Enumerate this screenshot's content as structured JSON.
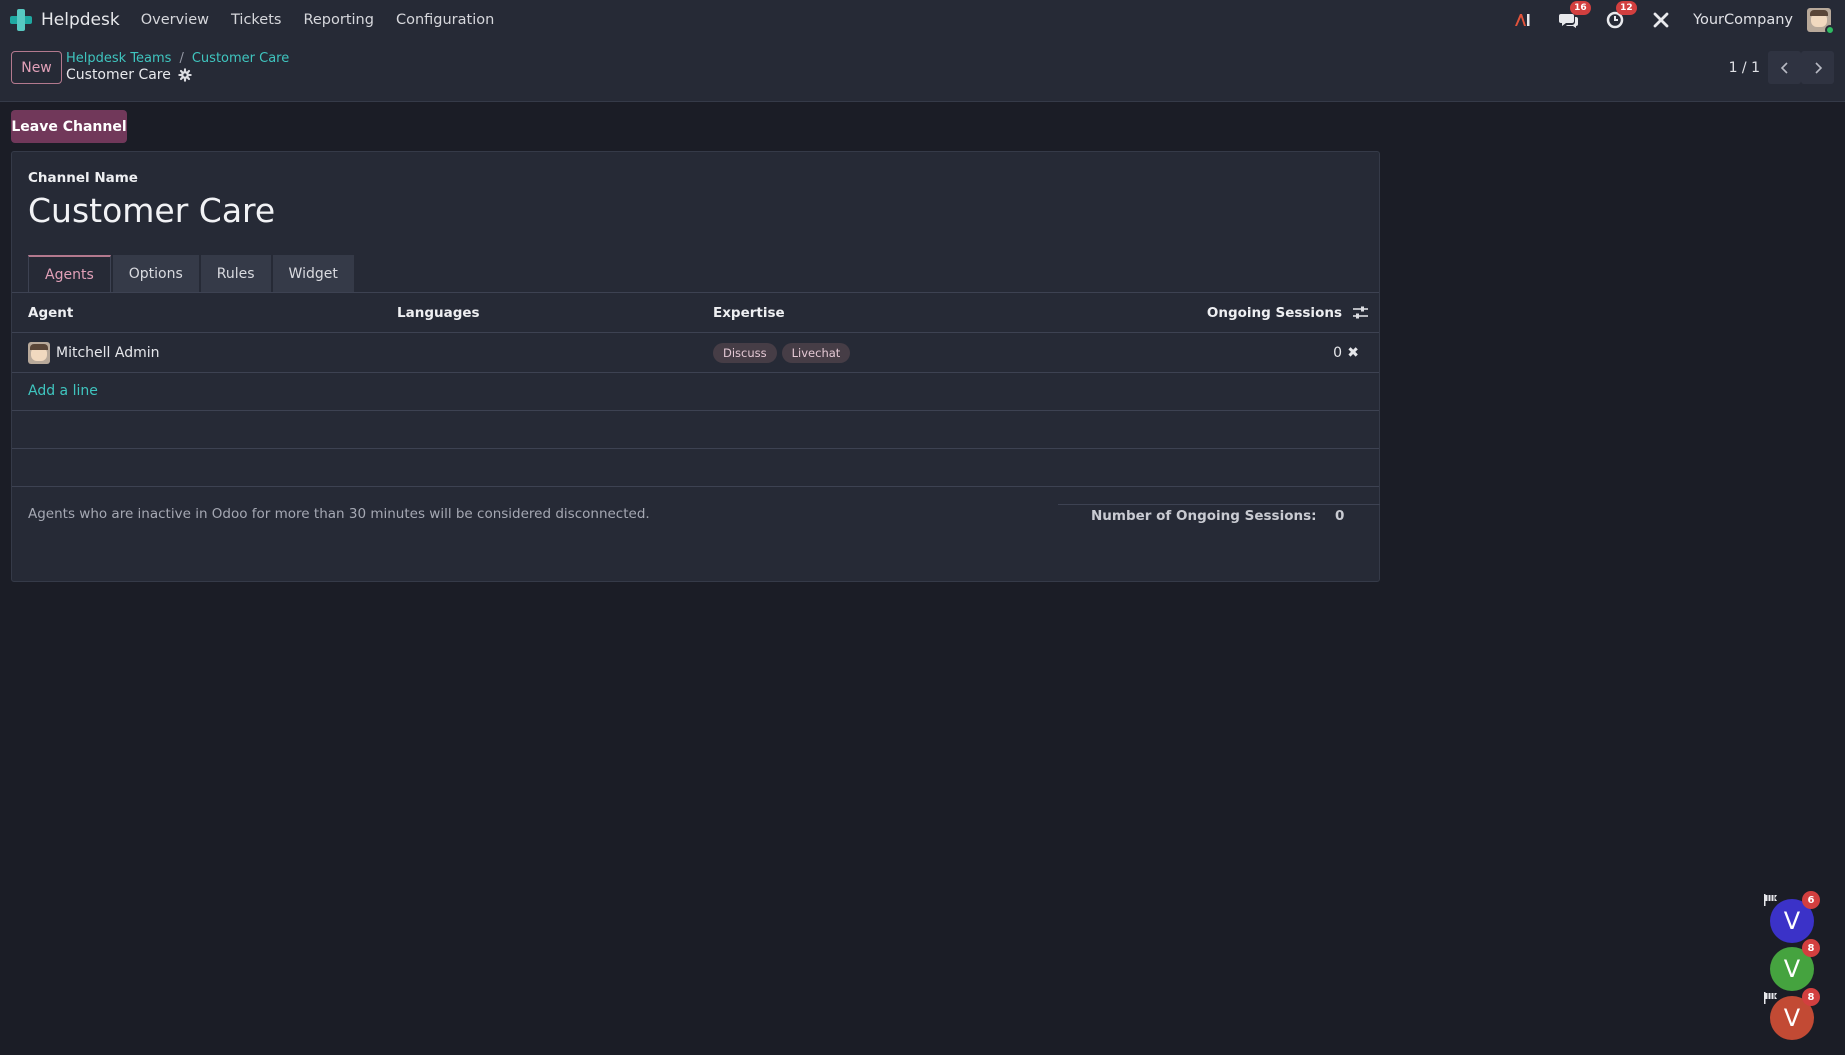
{
  "navbar": {
    "app_name": "Helpdesk",
    "menu": [
      "Overview",
      "Tickets",
      "Reporting",
      "Configuration"
    ],
    "messages_badge": "16",
    "activities_badge": "12",
    "company": "YourCompany"
  },
  "control_panel": {
    "new_label": "New",
    "breadcrumb": [
      "Helpdesk Teams",
      "Customer Care"
    ],
    "record_title": "Customer Care",
    "pager_value": "1 / 1"
  },
  "actions": {
    "leave_channel": "Leave Channel"
  },
  "form": {
    "channel_name_label": "Channel Name",
    "channel_name": "Customer Care",
    "tabs": [
      "Agents",
      "Options",
      "Rules",
      "Widget"
    ],
    "active_tab": "Agents",
    "table": {
      "headers": {
        "agent": "Agent",
        "languages": "Languages",
        "expertise": "Expertise",
        "ongoing_sessions": "Ongoing Sessions"
      },
      "rows": [
        {
          "agent": "Mitchell Admin",
          "languages": "",
          "expertise": [
            "Discuss",
            "Livechat"
          ],
          "ongoing_sessions": "0"
        }
      ],
      "add_line": "Add a line"
    },
    "footer_note": "Agents who are inactive in Odoo for more than 30 minutes will be considered disconnected.",
    "total_label": "Number of Ongoing Sessions:",
    "total_value": "0"
  },
  "chat_bubbles": [
    {
      "letter": "V",
      "count": "6",
      "color": "#3b32c8"
    },
    {
      "letter": "V",
      "count": "8",
      "color": "#45a33f"
    },
    {
      "letter": "V",
      "count": "8",
      "color": "#c24a34"
    }
  ],
  "colors": {
    "background": "#1b1d26",
    "panel": "#262a36",
    "accent": "#71385a",
    "link": "#3fc5bf",
    "badge": "#d23f3f"
  }
}
